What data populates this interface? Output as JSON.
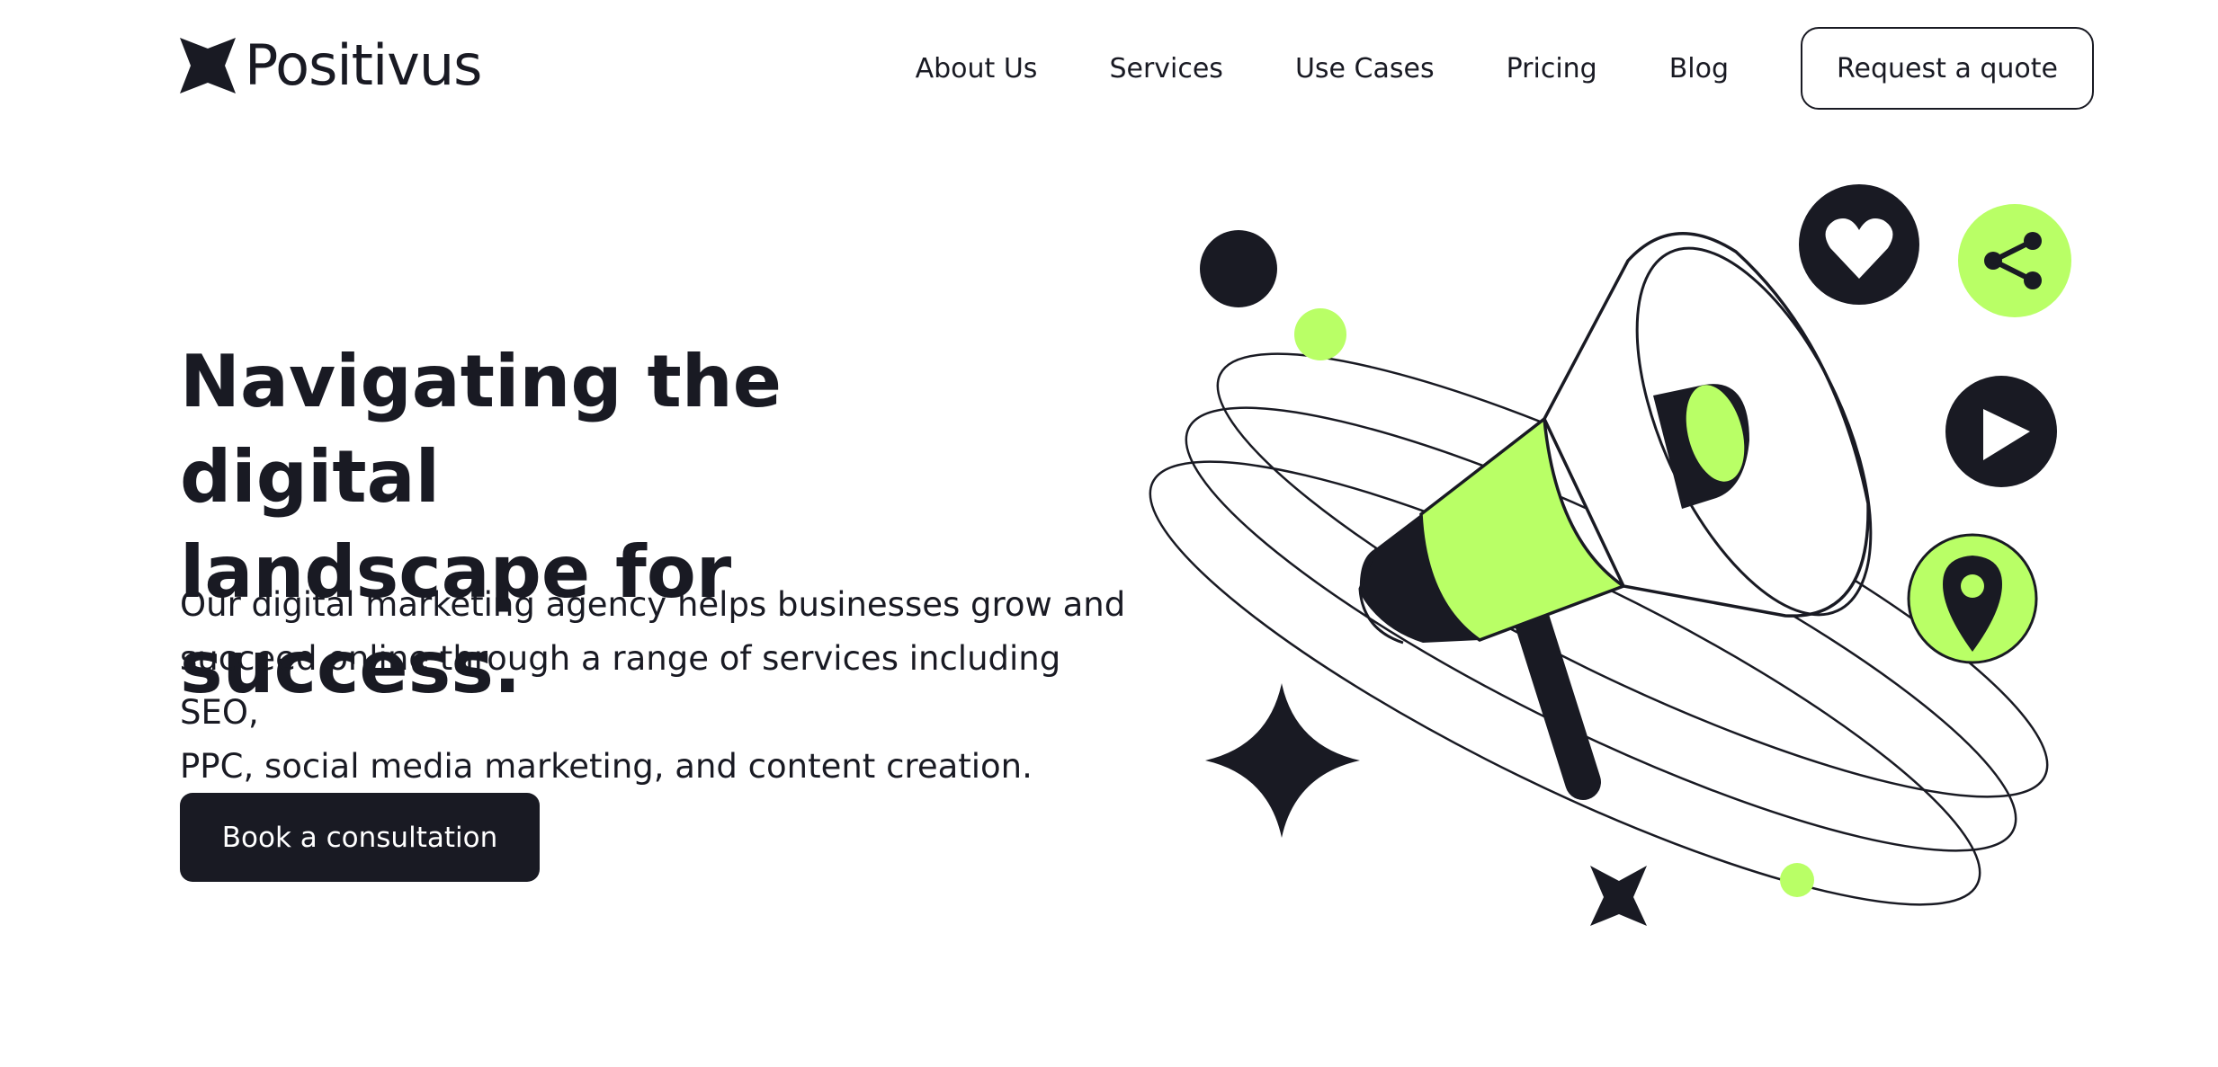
{
  "brand": {
    "name": "Positivus"
  },
  "nav": {
    "items": [
      {
        "label": "About Us"
      },
      {
        "label": "Services"
      },
      {
        "label": "Use Cases"
      },
      {
        "label": "Pricing"
      },
      {
        "label": "Blog"
      }
    ],
    "cta_label": "Request a quote"
  },
  "hero": {
    "title_line1": "Navigating the digital",
    "title_line2": "landscape for success.",
    "description_line1": "Our digital marketing agency helps businesses grow and",
    "description_line2": "succeed online through a range of services including SEO,",
    "description_line3": "PPC, social media marketing, and content creation.",
    "cta_label": "Book a consultation"
  },
  "colors": {
    "dark": "#191A23",
    "accent": "#B9FF66",
    "background": "#FFFFFF"
  },
  "illustration": {
    "icons": [
      "megaphone-icon",
      "heart-icon",
      "share-icon",
      "play-icon",
      "location-pin-icon",
      "sparkle-star-icon"
    ]
  }
}
